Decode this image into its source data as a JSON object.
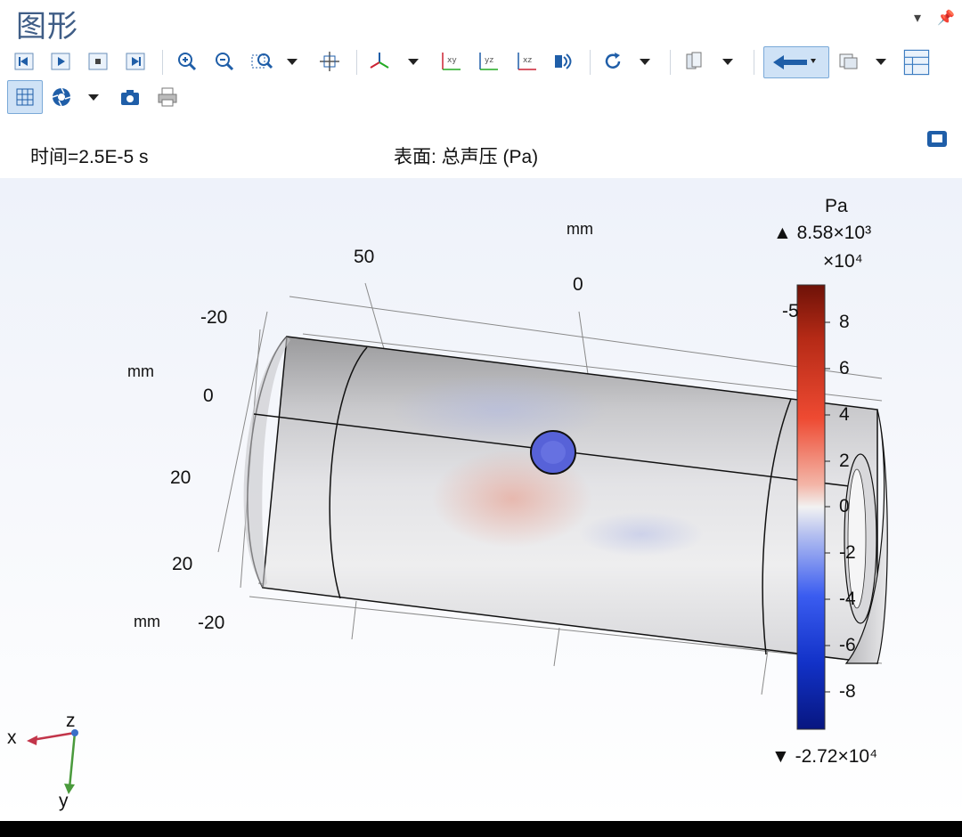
{
  "window": {
    "title": "图形"
  },
  "toolbar": {
    "row1_icons": [
      "step-back-icon",
      "play-icon",
      "stop-icon",
      "step-forward-icon",
      "zoom-in-icon",
      "zoom-out-icon",
      "zoom-box-icon",
      "zoom-extents-icon",
      "axes-icon",
      "xy-view-icon",
      "yz-view-icon",
      "xz-view-icon",
      "scene-light-icon",
      "rotate-icon",
      "view-icon",
      "transparency-icon",
      "grid-icon",
      "table-icon"
    ],
    "row2_icons": [
      "show-grid-icon",
      "camera-aperture-icon",
      "screenshot-icon",
      "print-icon"
    ]
  },
  "info": {
    "time_label": "时间=2.5E-5 s",
    "surface_label": "表面: 总声压 (Pa)"
  },
  "axes": {
    "top_unit": "mm",
    "top_ticks": [
      "50",
      "0",
      "-5"
    ],
    "left_unit": "mm",
    "left_ticks": [
      "-20",
      "0",
      "20"
    ],
    "bottom_unit": "mm",
    "bottom_ticks": [
      "20",
      "-20"
    ]
  },
  "colorbar": {
    "unit": "Pa",
    "max_label": "▲ 8.58×10³",
    "scale_label": "×10⁴",
    "ticks": [
      "8",
      "6",
      "4",
      "2",
      "0",
      "-2",
      "-4",
      "-6",
      "-8"
    ],
    "min_label": "▼ -2.72×10⁴",
    "colors": {
      "top": "#7a1a10",
      "mid": "#f2f2f2",
      "bottom": "#0a1f8f"
    }
  },
  "triad": {
    "x": "x",
    "y": "y",
    "z": "z"
  }
}
